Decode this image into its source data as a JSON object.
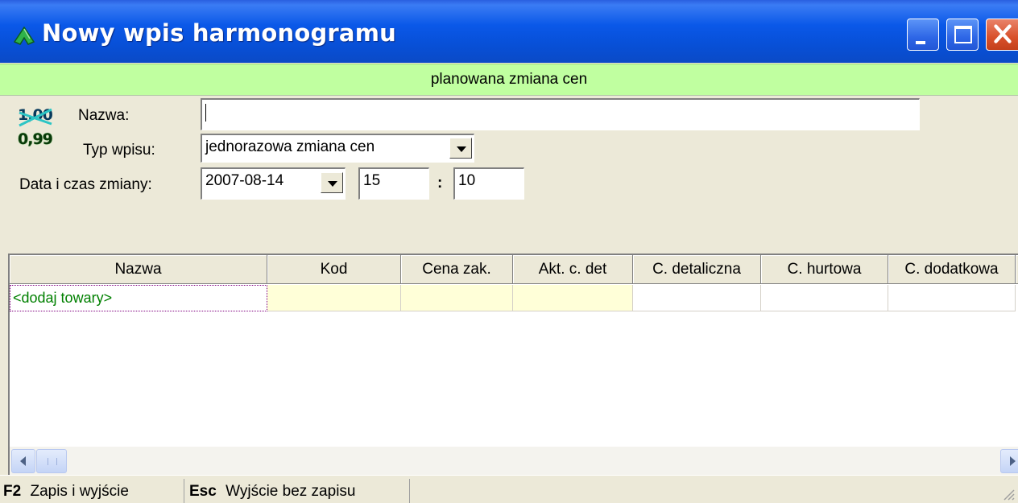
{
  "window": {
    "title": "Nowy wpis harmonogramu",
    "buttons": {
      "minimize": "minimize",
      "maximize": "maximize",
      "close": "close"
    }
  },
  "banner": "planowana zmiana cen",
  "form": {
    "icon_top": "1,00",
    "icon_bottom": "0,99",
    "name_label": "Nazwa:",
    "name_value": "",
    "type_label": "Typ wpisu:",
    "type_value": "jednorazowa zmiana cen",
    "date_label": "Data i czas zmiany:",
    "date_value": "2007-08-14",
    "hour_value": "15",
    "colon": ":",
    "minute_value": "10"
  },
  "grid": {
    "columns": [
      "Nazwa",
      "Kod",
      "Cena zak.",
      "Akt. c. det",
      "C. detaliczna",
      "C. hurtowa",
      "C. dodatkowa"
    ],
    "rows": [
      [
        "<dodaj towary>",
        "",
        "",
        "",
        "",
        "",
        ""
      ]
    ]
  },
  "statusbar": {
    "f2_key": "F2",
    "f2_label": "Zapis i wyjście",
    "esc_key": "Esc",
    "esc_label": "Wyjście bez zapisu"
  },
  "colors": {
    "titlebar": "#0a58e8",
    "banner": "#c0ffa0",
    "add_row_text": "#008000",
    "price_cells": "#ffffd8"
  },
  "icons": {
    "app": "green-leaf-icon",
    "price": "price-change-icon",
    "dropdown": "chevron-down-icon",
    "scroll_left": "arrow-left-icon",
    "scroll_right": "arrow-right-icon"
  }
}
